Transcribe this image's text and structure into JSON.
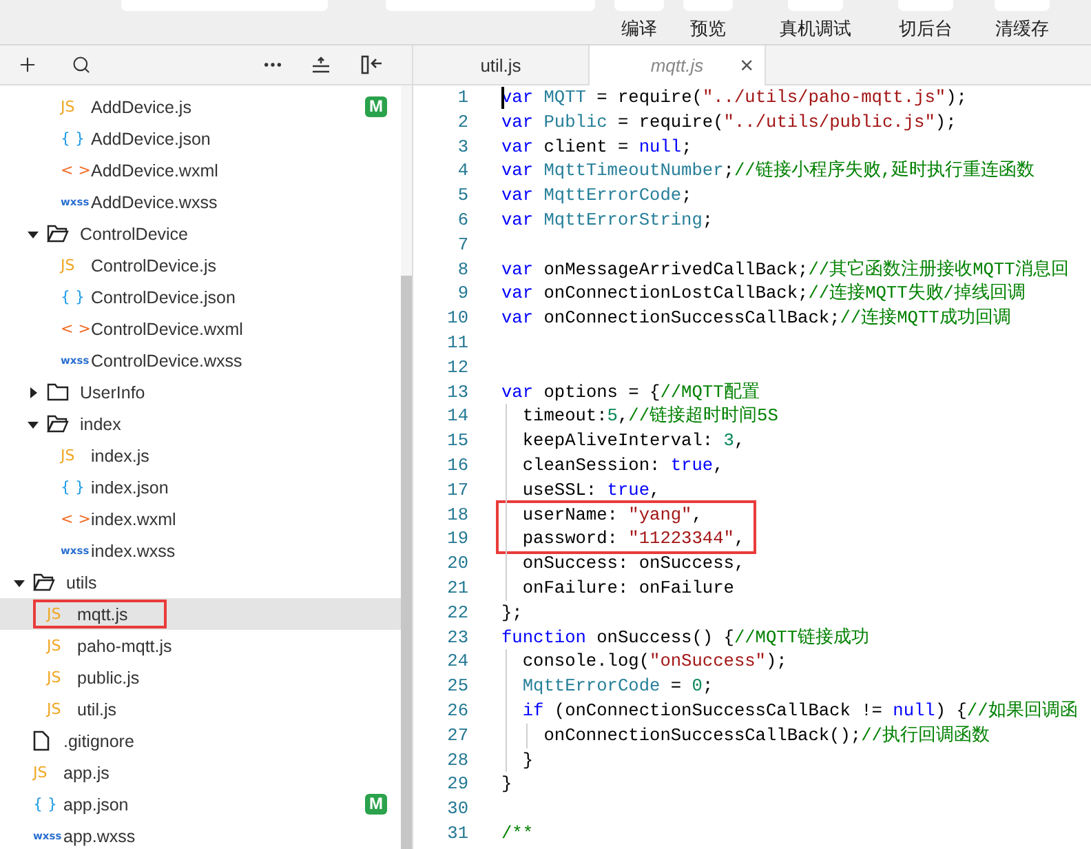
{
  "toolbar": {
    "buttons": [
      {
        "label": "编译"
      },
      {
        "label": "预览"
      },
      {
        "label": "真机调试"
      },
      {
        "label": "切后台"
      },
      {
        "label": "清缓存"
      }
    ]
  },
  "file_tree": [
    {
      "children": [
        {
          "children": [
            {
              "kind": "js",
              "glyph": "JS",
              "label": "AddDevice.js",
              "badge": "M",
              "selected": false,
              "highlighted": false
            },
            {
              "kind": "json",
              "glyph": "{ }",
              "label": "AddDevice.json",
              "selected": false,
              "highlighted": false
            },
            {
              "kind": "wxml",
              "glyph": "< >",
              "label": "AddDevice.wxml",
              "selected": false,
              "highlighted": false
            },
            {
              "kind": "wxss",
              "glyph": "wxss",
              "label": "AddDevice.wxss",
              "selected": false,
              "highlighted": false
            }
          ]
        },
        {
          "kind": "folder",
          "label": "ControlDevice",
          "expanded": true,
          "children": [
            {
              "kind": "js",
              "glyph": "JS",
              "label": "ControlDevice.js",
              "selected": false,
              "highlighted": false
            },
            {
              "kind": "json",
              "glyph": "{ }",
              "label": "ControlDevice.json",
              "selected": false,
              "highlighted": false
            },
            {
              "kind": "wxml",
              "glyph": "< >",
              "label": "ControlDevice.wxml",
              "selected": false,
              "highlighted": false
            },
            {
              "kind": "wxss",
              "glyph": "wxss",
              "label": "ControlDevice.wxss",
              "selected": false,
              "highlighted": false
            }
          ]
        },
        {
          "kind": "folder",
          "label": "UserInfo",
          "expanded": false
        },
        {
          "kind": "folder",
          "label": "index",
          "expanded": true,
          "children": [
            {
              "kind": "js",
              "glyph": "JS",
              "label": "index.js",
              "selected": false,
              "highlighted": false
            },
            {
              "kind": "json",
              "glyph": "{ }",
              "label": "index.json",
              "selected": false,
              "highlighted": false
            },
            {
              "kind": "wxml",
              "glyph": "< >",
              "label": "index.wxml",
              "selected": false,
              "highlighted": false
            },
            {
              "kind": "wxss",
              "glyph": "wxss",
              "label": "index.wxss",
              "selected": false,
              "highlighted": false
            }
          ]
        }
      ]
    },
    {
      "kind": "folder",
      "label": "utils",
      "expanded": true,
      "children": [
        {
          "kind": "js",
          "glyph": "JS",
          "label": "mqtt.js",
          "selected": true,
          "highlighted": true
        },
        {
          "kind": "js",
          "glyph": "JS",
          "label": "paho-mqtt.js",
          "selected": false,
          "highlighted": false
        },
        {
          "kind": "js",
          "glyph": "JS",
          "label": "public.js",
          "selected": false,
          "highlighted": false
        },
        {
          "kind": "js",
          "glyph": "JS",
          "label": "util.js",
          "selected": false,
          "highlighted": false
        }
      ]
    },
    {
      "kind": "file",
      "label": ".gitignore",
      "selected": false,
      "highlighted": false
    },
    {
      "kind": "js",
      "glyph": "JS",
      "label": "app.js",
      "selected": false,
      "highlighted": false
    },
    {
      "kind": "json",
      "glyph": "{ }",
      "label": "app.json",
      "badge": "M",
      "selected": false,
      "highlighted": false
    },
    {
      "kind": "wxss",
      "glyph": "wxss",
      "label": "app.wxss",
      "selected": false,
      "highlighted": false
    }
  ],
  "editor_tabs": [
    {
      "label": "util.js",
      "selected": false
    },
    {
      "label": "mqtt.js",
      "selected": true,
      "close": "×"
    }
  ],
  "code": [
    {
      "number": "1",
      "highlighted": false,
      "tokens": [
        {
          "kind": "kw",
          "text": "var"
        },
        {
          "kind": "type",
          "text": " MQTT"
        },
        {
          "kind": "plain",
          "text": " = require("
        },
        {
          "kind": "str",
          "text": "\"../utils/paho-mqtt.js\""
        },
        {
          "kind": "plain",
          "text": ");"
        }
      ]
    },
    {
      "number": "2",
      "highlighted": false,
      "tokens": [
        {
          "kind": "kw",
          "text": "var"
        },
        {
          "kind": "type",
          "text": " Public"
        },
        {
          "kind": "plain",
          "text": " = require("
        },
        {
          "kind": "str",
          "text": "\"../utils/public.js\""
        },
        {
          "kind": "plain",
          "text": ");"
        }
      ]
    },
    {
      "number": "3",
      "highlighted": false,
      "tokens": [
        {
          "kind": "kw",
          "text": "var"
        },
        {
          "kind": "plain",
          "text": " client = "
        },
        {
          "kind": "kw",
          "text": "null"
        },
        {
          "kind": "plain",
          "text": ";"
        }
      ]
    },
    {
      "number": "4",
      "highlighted": false,
      "tokens": [
        {
          "kind": "kw",
          "text": "var"
        },
        {
          "kind": "type",
          "text": " MqttTimeoutNumber"
        },
        {
          "kind": "plain",
          "text": ";"
        },
        {
          "kind": "cmt",
          "text": "//链接小程序失败,延时执行重连函数"
        }
      ]
    },
    {
      "number": "5",
      "highlighted": false,
      "tokens": [
        {
          "kind": "kw",
          "text": "var"
        },
        {
          "kind": "type",
          "text": " MqttErrorCode"
        },
        {
          "kind": "plain",
          "text": ";"
        }
      ]
    },
    {
      "number": "6",
      "highlighted": false,
      "tokens": [
        {
          "kind": "kw",
          "text": "var"
        },
        {
          "kind": "type",
          "text": " MqttErrorString"
        },
        {
          "kind": "plain",
          "text": ";"
        }
      ]
    },
    {
      "number": "7",
      "highlighted": false
    },
    {
      "number": "8",
      "highlighted": false,
      "tokens": [
        {
          "kind": "kw",
          "text": "var"
        },
        {
          "kind": "plain",
          "text": " onMessageArrivedCallBack;"
        },
        {
          "kind": "cmt",
          "text": "//其它函数注册接收MQTT消息回"
        }
      ]
    },
    {
      "number": "9",
      "highlighted": false,
      "tokens": [
        {
          "kind": "kw",
          "text": "var"
        },
        {
          "kind": "plain",
          "text": " onConnectionLostCallBack;"
        },
        {
          "kind": "cmt",
          "text": "//连接MQTT失败/掉线回调"
        }
      ]
    },
    {
      "number": "10",
      "highlighted": false,
      "tokens": [
        {
          "kind": "kw",
          "text": "var"
        },
        {
          "kind": "plain",
          "text": " onConnectionSuccessCallBack;"
        },
        {
          "kind": "cmt",
          "text": "//连接MQTT成功回调"
        }
      ]
    },
    {
      "number": "11",
      "highlighted": false
    },
    {
      "number": "12",
      "highlighted": false
    },
    {
      "number": "13",
      "highlighted": false,
      "tokens": [
        {
          "kind": "kw",
          "text": "var"
        },
        {
          "kind": "plain",
          "text": " options = {"
        },
        {
          "kind": "cmt",
          "text": "//MQTT配置"
        }
      ]
    },
    {
      "number": "14",
      "highlighted": false,
      "tokens": [
        {
          "kind": "plain",
          "text": "  timeout:"
        },
        {
          "kind": "num",
          "text": "5"
        },
        {
          "kind": "plain",
          "text": ","
        },
        {
          "kind": "cmt",
          "text": "//链接超时时间5S"
        }
      ]
    },
    {
      "number": "15",
      "highlighted": false,
      "tokens": [
        {
          "kind": "plain",
          "text": "  keepAliveInterval: "
        },
        {
          "kind": "num",
          "text": "3"
        },
        {
          "kind": "plain",
          "text": ","
        }
      ]
    },
    {
      "number": "16",
      "highlighted": false,
      "tokens": [
        {
          "kind": "plain",
          "text": "  cleanSession: "
        },
        {
          "kind": "kw",
          "text": "true"
        },
        {
          "kind": "plain",
          "text": ","
        }
      ]
    },
    {
      "number": "17",
      "highlighted": false,
      "tokens": [
        {
          "kind": "plain",
          "text": "  useSSL: "
        },
        {
          "kind": "kw",
          "text": "true"
        },
        {
          "kind": "plain",
          "text": ","
        }
      ]
    },
    {
      "number": "18",
      "highlighted": true,
      "tokens": [
        {
          "kind": "plain",
          "text": "  userName: "
        },
        {
          "kind": "str",
          "text": "\"yang\""
        },
        {
          "kind": "plain",
          "text": ","
        }
      ]
    },
    {
      "number": "19",
      "highlighted": true,
      "tokens": [
        {
          "kind": "plain",
          "text": "  password: "
        },
        {
          "kind": "str",
          "text": "\"11223344\""
        },
        {
          "kind": "plain",
          "text": ","
        }
      ]
    },
    {
      "number": "20",
      "highlighted": false,
      "tokens": [
        {
          "kind": "plain",
          "text": "  onSuccess: onSuccess,"
        }
      ]
    },
    {
      "number": "21",
      "highlighted": false,
      "tokens": [
        {
          "kind": "plain",
          "text": "  onFailure: onFailure"
        }
      ]
    },
    {
      "number": "22",
      "highlighted": false,
      "tokens": [
        {
          "kind": "plain",
          "text": "};"
        }
      ]
    },
    {
      "number": "23",
      "highlighted": false,
      "tokens": [
        {
          "kind": "kw",
          "text": "function"
        },
        {
          "kind": "plain",
          "text": " onSuccess() {"
        },
        {
          "kind": "cmt",
          "text": "//MQTT链接成功"
        }
      ]
    },
    {
      "number": "24",
      "highlighted": false,
      "tokens": [
        {
          "kind": "plain",
          "text": "  console.log("
        },
        {
          "kind": "str",
          "text": "\"onSuccess\""
        },
        {
          "kind": "plain",
          "text": ");"
        }
      ]
    },
    {
      "number": "25",
      "highlighted": false,
      "tokens": [
        {
          "kind": "type",
          "text": "  MqttErrorCode"
        },
        {
          "kind": "plain",
          "text": " = "
        },
        {
          "kind": "num",
          "text": "0"
        },
        {
          "kind": "plain",
          "text": ";"
        }
      ]
    },
    {
      "number": "26",
      "highlighted": false,
      "tokens": [
        {
          "kind": "kw",
          "text": "  if"
        },
        {
          "kind": "plain",
          "text": " (onConnectionSuccessCallBack != "
        },
        {
          "kind": "kw",
          "text": "null"
        },
        {
          "kind": "plain",
          "text": ") {"
        },
        {
          "kind": "cmt",
          "text": "//如果回调函"
        }
      ]
    },
    {
      "number": "27",
      "highlighted": false,
      "tokens": [
        {
          "kind": "plain",
          "text": "    onConnectionSuccessCallBack();"
        },
        {
          "kind": "cmt",
          "text": "//执行回调函数"
        }
      ]
    },
    {
      "number": "28",
      "highlighted": false,
      "tokens": [
        {
          "kind": "plain",
          "text": "  }"
        }
      ]
    },
    {
      "number": "29",
      "highlighted": false,
      "tokens": [
        {
          "kind": "plain",
          "text": "}"
        }
      ]
    },
    {
      "number": "30",
      "highlighted": false
    },
    {
      "number": "31",
      "highlighted": false,
      "tokens": [
        {
          "kind": "cmt",
          "text": "/**"
        }
      ]
    }
  ]
}
